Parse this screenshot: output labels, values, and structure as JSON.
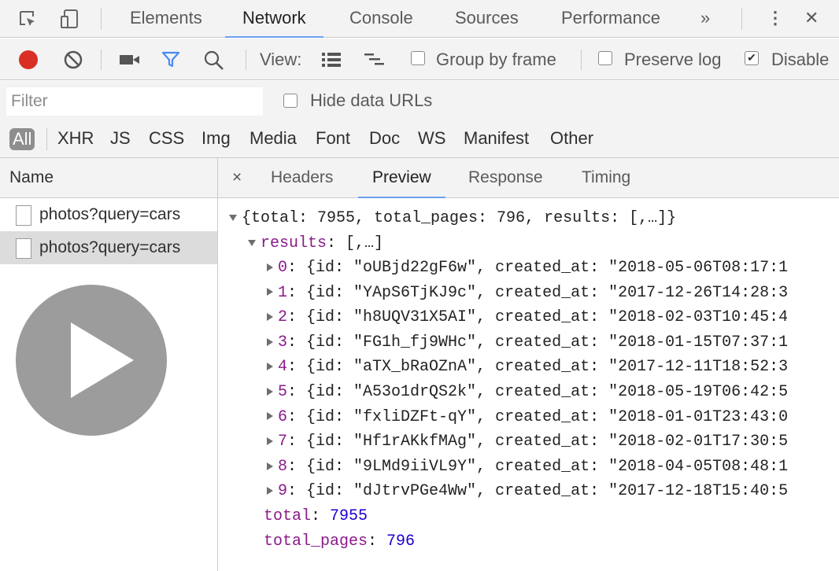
{
  "topbar": {
    "tabs": [
      "Elements",
      "Network",
      "Console",
      "Sources",
      "Performance"
    ],
    "active_tab": "Network",
    "more_glyph": "»",
    "menu_glyph": "⋮",
    "close_glyph": "✕"
  },
  "toolbar": {
    "view_label": "View:",
    "group_by_frame_label": "Group by frame",
    "preserve_log_label": "Preserve log",
    "disable_cache_label": "Disable"
  },
  "filter": {
    "placeholder": "Filter",
    "hide_data_urls_label": "Hide data URLs"
  },
  "types": [
    "All",
    "XHR",
    "JS",
    "CSS",
    "Img",
    "Media",
    "Font",
    "Doc",
    "WS",
    "Manifest",
    "Other"
  ],
  "requests": {
    "header": "Name",
    "items": [
      "photos?query=cars",
      "photos?query=cars"
    ],
    "selected_index": 1
  },
  "detail": {
    "close_glyph": "×",
    "tabs": [
      "Headers",
      "Preview",
      "Response",
      "Timing"
    ],
    "active_tab": "Preview"
  },
  "preview": {
    "summary": "{total: 7955, total_pages: 796, results: [,…]}",
    "results_key": "results",
    "results_summary": ": [,…]",
    "items": [
      {
        "index": "0",
        "id": "\"oUBjd22gF6w\"",
        "created_at": "\"2018-05-06T08:17:1"
      },
      {
        "index": "1",
        "id": "\"YApS6TjKJ9c\"",
        "created_at": "\"2017-12-26T14:28:3"
      },
      {
        "index": "2",
        "id": "\"h8UQV31X5AI\"",
        "created_at": "\"2018-02-03T10:45:4"
      },
      {
        "index": "3",
        "id": "\"FG1h_fj9WHc\"",
        "created_at": "\"2018-01-15T07:37:1"
      },
      {
        "index": "4",
        "id": "\"aTX_bRaOZnA\"",
        "created_at": "\"2017-12-11T18:52:3"
      },
      {
        "index": "5",
        "id": "\"A53o1drQS2k\"",
        "created_at": "\"2018-05-19T06:42:5"
      },
      {
        "index": "6",
        "id": "\"fxliDZFt-qY\"",
        "created_at": "\"2018-01-01T23:43:0"
      },
      {
        "index": "7",
        "id": "\"Hf1rAKkfMAg\"",
        "created_at": "\"2018-02-01T17:30:5"
      },
      {
        "index": "8",
        "id": "\"9LMd9iiVL9Y\"",
        "created_at": "\"2018-04-05T08:48:1"
      },
      {
        "index": "9",
        "id": "\"dJtrvPGe4Ww\"",
        "created_at": "\"2017-12-18T15:40:5"
      }
    ],
    "total_key": "total",
    "total_value": "7955",
    "total_pages_key": "total_pages",
    "total_pages_value": "796"
  },
  "colors": {
    "record": "#d93025",
    "filter_active": "#4a8af4",
    "active_tab_underline": "#6aa0f0"
  }
}
